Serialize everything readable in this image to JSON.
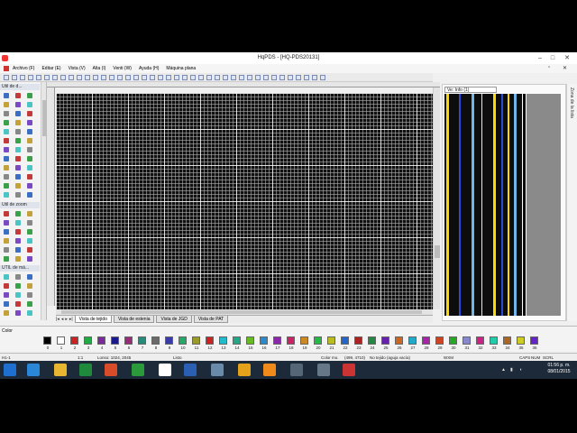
{
  "window": {
    "title": "HqPDS - [HQ-PDS20131]"
  },
  "menu": [
    "Archivo (F)",
    "Editar (E)",
    "Vista (V)",
    "Alta (I)",
    "Venti (W)",
    "Ayuda (H)",
    "Máquina plana"
  ],
  "tool_panel": {
    "section1": "Util de d...",
    "section2": "Util de zoom",
    "section3": "UTIL de má..."
  },
  "preview": {
    "header": "Ve: Info (1)",
    "side_label": "Zona de la lista"
  },
  "tabs": [
    "Vista de tejido",
    "Vista de estenia",
    "Vista de JGD",
    "Vista de PAT"
  ],
  "colorbar": {
    "label": "Color",
    "numbers": [
      "0",
      "1",
      "2",
      "3",
      "4",
      "5",
      "6",
      "7",
      "8",
      "9",
      "10",
      "11",
      "12",
      "13",
      "14",
      "15",
      "16",
      "17",
      "18",
      "19",
      "20",
      "21",
      "22",
      "23",
      "24",
      "25",
      "26",
      "27",
      "28",
      "29",
      "30",
      "31",
      "32",
      "33",
      "34",
      "35",
      "36"
    ],
    "swatch_colors": [
      "#000000",
      "#ffffff",
      "#cc2222",
      "#22aa44",
      "#7a2a9a",
      "#1a1a8a",
      "#9a2a7a",
      "#2a8a7a",
      "#6a6a6a",
      "#3a3aaa",
      "#22aa66",
      "#9a9a2a",
      "#cc2222",
      "#22bbcc",
      "#22aa88",
      "#66bb22",
      "#2a8acc",
      "#8a2aaa",
      "#cc2266",
      "#cc8822",
      "#22bb44",
      "#bbbb22",
      "#2266cc",
      "#aa2222",
      "#228844",
      "#6622aa",
      "#cc6622",
      "#22aacc",
      "#aa22aa",
      "#cc4422",
      "#22aa22",
      "#8888cc",
      "#cc2288",
      "#22ccaa",
      "#aa6622",
      "#cccc22",
      "#6622cc"
    ]
  },
  "status": {
    "left": "H1-1",
    "scale": "1:1",
    "size": "Lonso: 1024, 2045",
    "ready": "Listo",
    "color": "Color mo.",
    "coords": "(499, 4710)",
    "no_tejido": "No tejido (aguja vacía)",
    "mode": "WXM",
    "caps": "CAPS",
    "num": "NUM",
    "scrl": "SCRL"
  },
  "clock": {
    "time": "01:56 p. m.",
    "date": "08/01/2015"
  },
  "preview_stripes": [
    {
      "color": "#ffd800",
      "pos": 0.02,
      "w": 3
    },
    {
      "color": "#2a4ad8",
      "pos": 0.18,
      "w": 2
    },
    {
      "color": "#6fb7e6",
      "pos": 0.33,
      "w": 3
    },
    {
      "color": "#e8e8e8",
      "pos": 0.46,
      "w": 1
    },
    {
      "color": "#ffd800",
      "pos": 0.6,
      "w": 3
    },
    {
      "color": "#2a4ad8",
      "pos": 0.7,
      "w": 2
    },
    {
      "color": "#ffd800",
      "pos": 0.78,
      "w": 2
    },
    {
      "color": "#6fb7e6",
      "pos": 0.86,
      "w": 3
    },
    {
      "color": "#ffffff",
      "pos": 0.95,
      "w": 1
    }
  ]
}
